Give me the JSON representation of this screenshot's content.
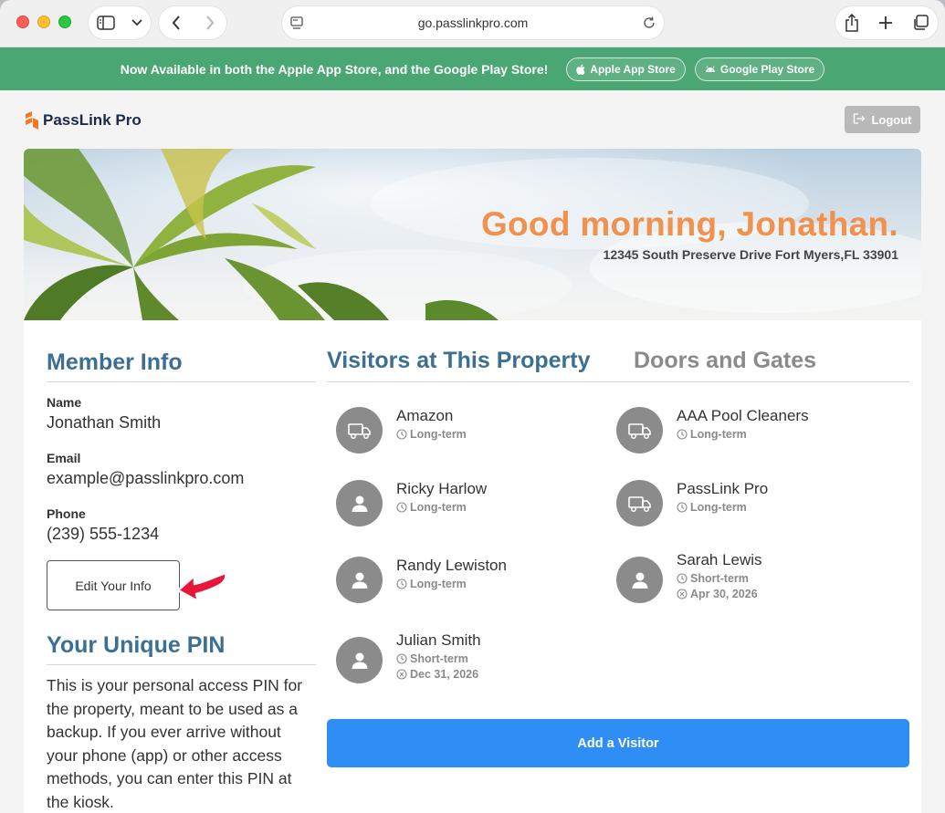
{
  "browser": {
    "url": "go.passlinkpro.com"
  },
  "banner": {
    "text": "Now Available in both the Apple App Store, and the Google Play Store!",
    "apple_label": "Apple App Store",
    "google_label": "Google Play Store"
  },
  "header": {
    "brand": "PassLink Pro",
    "logout_label": "Logout"
  },
  "hero": {
    "greeting": "Good morning, Jonathan.",
    "address": "12345 South Preserve Drive Fort Myers,FL 33901"
  },
  "member": {
    "title": "Member Info",
    "name_label": "Name",
    "name": "Jonathan Smith",
    "email_label": "Email",
    "email": "example@passlinkpro.com",
    "phone_label": "Phone",
    "phone": "(239) 555-1234",
    "edit_label": "Edit Your Info"
  },
  "pin": {
    "title": "Your Unique PIN",
    "description": "This is your personal access PIN for the property, meant to be used as a backup. If you ever arrive without your phone (app) or other access methods, you can enter this PIN at the kiosk."
  },
  "tabs": {
    "visitors": "Visitors at This Property",
    "doors": "Doors and Gates"
  },
  "visitors": [
    {
      "name": "Amazon",
      "term": "Long-term",
      "icon": "truck-icon"
    },
    {
      "name": "AAA Pool Cleaners",
      "term": "Long-term",
      "icon": "truck-icon"
    },
    {
      "name": "Ricky Harlow",
      "term": "Long-term",
      "icon": "person-icon"
    },
    {
      "name": "PassLink Pro",
      "term": "Long-term",
      "icon": "truck-icon"
    },
    {
      "name": "Randy Lewiston",
      "term": "Long-term",
      "icon": "person-icon"
    },
    {
      "name": "Sarah Lewis",
      "term": "Short-term",
      "expires": "Apr 30, 2026",
      "icon": "person-icon"
    },
    {
      "name": "Julian Smith",
      "term": "Short-term",
      "expires": "Dec 31, 2026",
      "icon": "person-icon"
    }
  ],
  "add_visitor_label": "Add a Visitor",
  "colors": {
    "banner": "#4aa673",
    "heading": "#3b6f93",
    "greeting": "#f0924e",
    "primary_button": "#2f8ef5",
    "annotation_arrow": "#e8173a"
  }
}
